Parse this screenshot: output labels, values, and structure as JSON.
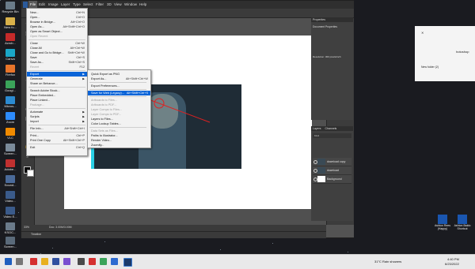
{
  "photoshop": {
    "menubar": [
      "File",
      "Edit",
      "Image",
      "Layer",
      "Type",
      "Select",
      "Filter",
      "3D",
      "View",
      "Window",
      "Help"
    ],
    "options_text": "Image: ?  Size Transform Controls",
    "status_zoom": "33%",
    "status_doc": "Doc: 3.00M/3.00M",
    "status_timeline": "Timeline"
  },
  "file_menu": [
    {
      "label": "New...",
      "shortcut": "Ctrl+N",
      "disabled": false
    },
    {
      "label": "Open...",
      "shortcut": "Ctrl+O",
      "disabled": false
    },
    {
      "label": "Browse in Bridge...",
      "shortcut": "Alt+Ctrl+O",
      "disabled": false
    },
    {
      "label": "Open As...",
      "shortcut": "Alt+Shift+Ctrl+O",
      "disabled": false
    },
    {
      "label": "Open as Smart Object...",
      "shortcut": "",
      "disabled": false
    },
    {
      "label": "Open Recent",
      "shortcut": "",
      "disabled": true
    },
    {
      "sep": true
    },
    {
      "label": "Close",
      "shortcut": "Ctrl+W",
      "disabled": false
    },
    {
      "label": "Close All",
      "shortcut": "Alt+Ctrl+W",
      "disabled": false
    },
    {
      "label": "Close and Go to Bridge...",
      "shortcut": "Shift+Ctrl+W",
      "disabled": false
    },
    {
      "label": "Save",
      "shortcut": "Ctrl+S",
      "disabled": false
    },
    {
      "label": "Save As...",
      "shortcut": "Shift+Ctrl+S",
      "disabled": false
    },
    {
      "label": "Revert",
      "shortcut": "F12",
      "disabled": true
    },
    {
      "sep": true
    },
    {
      "label": "Export",
      "shortcut": "",
      "disabled": false,
      "highlighted": true,
      "submenu": true
    },
    {
      "label": "Generate",
      "shortcut": "",
      "disabled": false,
      "submenu": true
    },
    {
      "label": "Share on Behance...",
      "shortcut": "",
      "disabled": false
    },
    {
      "sep": true
    },
    {
      "label": "Search Adobe Stock...",
      "shortcut": "",
      "disabled": false
    },
    {
      "label": "Place Embedded...",
      "shortcut": "",
      "disabled": false
    },
    {
      "label": "Place Linked...",
      "shortcut": "",
      "disabled": false
    },
    {
      "label": "Package...",
      "shortcut": "",
      "disabled": true
    },
    {
      "sep": true
    },
    {
      "label": "Automate",
      "shortcut": "",
      "disabled": false,
      "submenu": true
    },
    {
      "label": "Scripts",
      "shortcut": "",
      "disabled": false,
      "submenu": true
    },
    {
      "label": "Import",
      "shortcut": "",
      "disabled": false,
      "submenu": true
    },
    {
      "sep": true
    },
    {
      "label": "File Info...",
      "shortcut": "Alt+Shift+Ctrl+I",
      "disabled": false
    },
    {
      "sep": true
    },
    {
      "label": "Print...",
      "shortcut": "Ctrl+P",
      "disabled": false
    },
    {
      "label": "Print One Copy",
      "shortcut": "Alt+Shift+Ctrl+P",
      "disabled": false
    },
    {
      "sep": true
    },
    {
      "label": "Exit",
      "shortcut": "Ctrl+Q",
      "disabled": false
    }
  ],
  "export_menu": [
    {
      "label": "Quick Export as PNG",
      "shortcut": "",
      "disabled": false
    },
    {
      "label": "Export As...",
      "shortcut": "Alt+Shift+Ctrl+W",
      "disabled": false
    },
    {
      "sep": true
    },
    {
      "label": "Export Preferences...",
      "shortcut": "",
      "disabled": false
    },
    {
      "sep": true
    },
    {
      "label": "Save for Web (Legacy)...",
      "shortcut": "Alt+Shift+Ctrl+S",
      "disabled": false,
      "highlighted": true
    },
    {
      "sep": true
    },
    {
      "label": "Artboards to Files...",
      "shortcut": "",
      "disabled": true
    },
    {
      "label": "Artboards to PDF...",
      "shortcut": "",
      "disabled": true
    },
    {
      "label": "Layer Comps to Files...",
      "shortcut": "",
      "disabled": true
    },
    {
      "label": "Layer Comps to PDF...",
      "shortcut": "",
      "disabled": true
    },
    {
      "label": "Layers to Files...",
      "shortcut": "",
      "disabled": false
    },
    {
      "label": "Color Lookup Tables...",
      "shortcut": "",
      "disabled": false
    },
    {
      "sep": true
    },
    {
      "label": "Data Sets as Files...",
      "shortcut": "",
      "disabled": true
    },
    {
      "label": "Paths to Illustrator...",
      "shortcut": "",
      "disabled": false
    },
    {
      "label": "Render Video...",
      "shortcut": "",
      "disabled": false
    },
    {
      "label": "Zoomify...",
      "shortcut": "",
      "disabled": false
    }
  ],
  "properties_panel": {
    "title": "Properties",
    "doc_label": "Document Properties",
    "resolution": "Resolution: 300 pixels/inch"
  },
  "layers_panel": {
    "tabs": [
      "Layers",
      "Channels"
    ],
    "filter_label": "Kind",
    "layers": [
      "download copy",
      "download",
      "Background"
    ]
  },
  "desktop_left_icons": [
    "Recycle Bin",
    "New fo...",
    "Acrob...",
    "Canva",
    "Firefox",
    "Googl...",
    "Micros...",
    "Zoom",
    "VLC",
    "Screen...",
    "Adobe...",
    "Sound...",
    "Video...",
    "Video E...",
    "KSOC...",
    "Screen...",
    "Kind...",
    "Screen..."
  ],
  "right_desktop": {
    "top_text": "Hard AnyMP4 4-Action",
    "top_text2": "Unigram",
    "side_label": "hotoshop",
    "new_folder": "New folder (2)",
    "icons": [
      {
        "label": "Ashton Rees (Happy)"
      },
      {
        "label": "Ashton Baldo Shortcut"
      }
    ]
  },
  "taskbar": {
    "weather": "31°C  Rain showers",
    "time": "4:40 PM",
    "date": "6/23/2022",
    "left_items": [
      "Ashton",
      "Ashton B..."
    ]
  },
  "colors": {
    "menu_highlight": "#0a64d8",
    "ps_dark": "#535353",
    "desktop_bg": "#1a1b20"
  }
}
